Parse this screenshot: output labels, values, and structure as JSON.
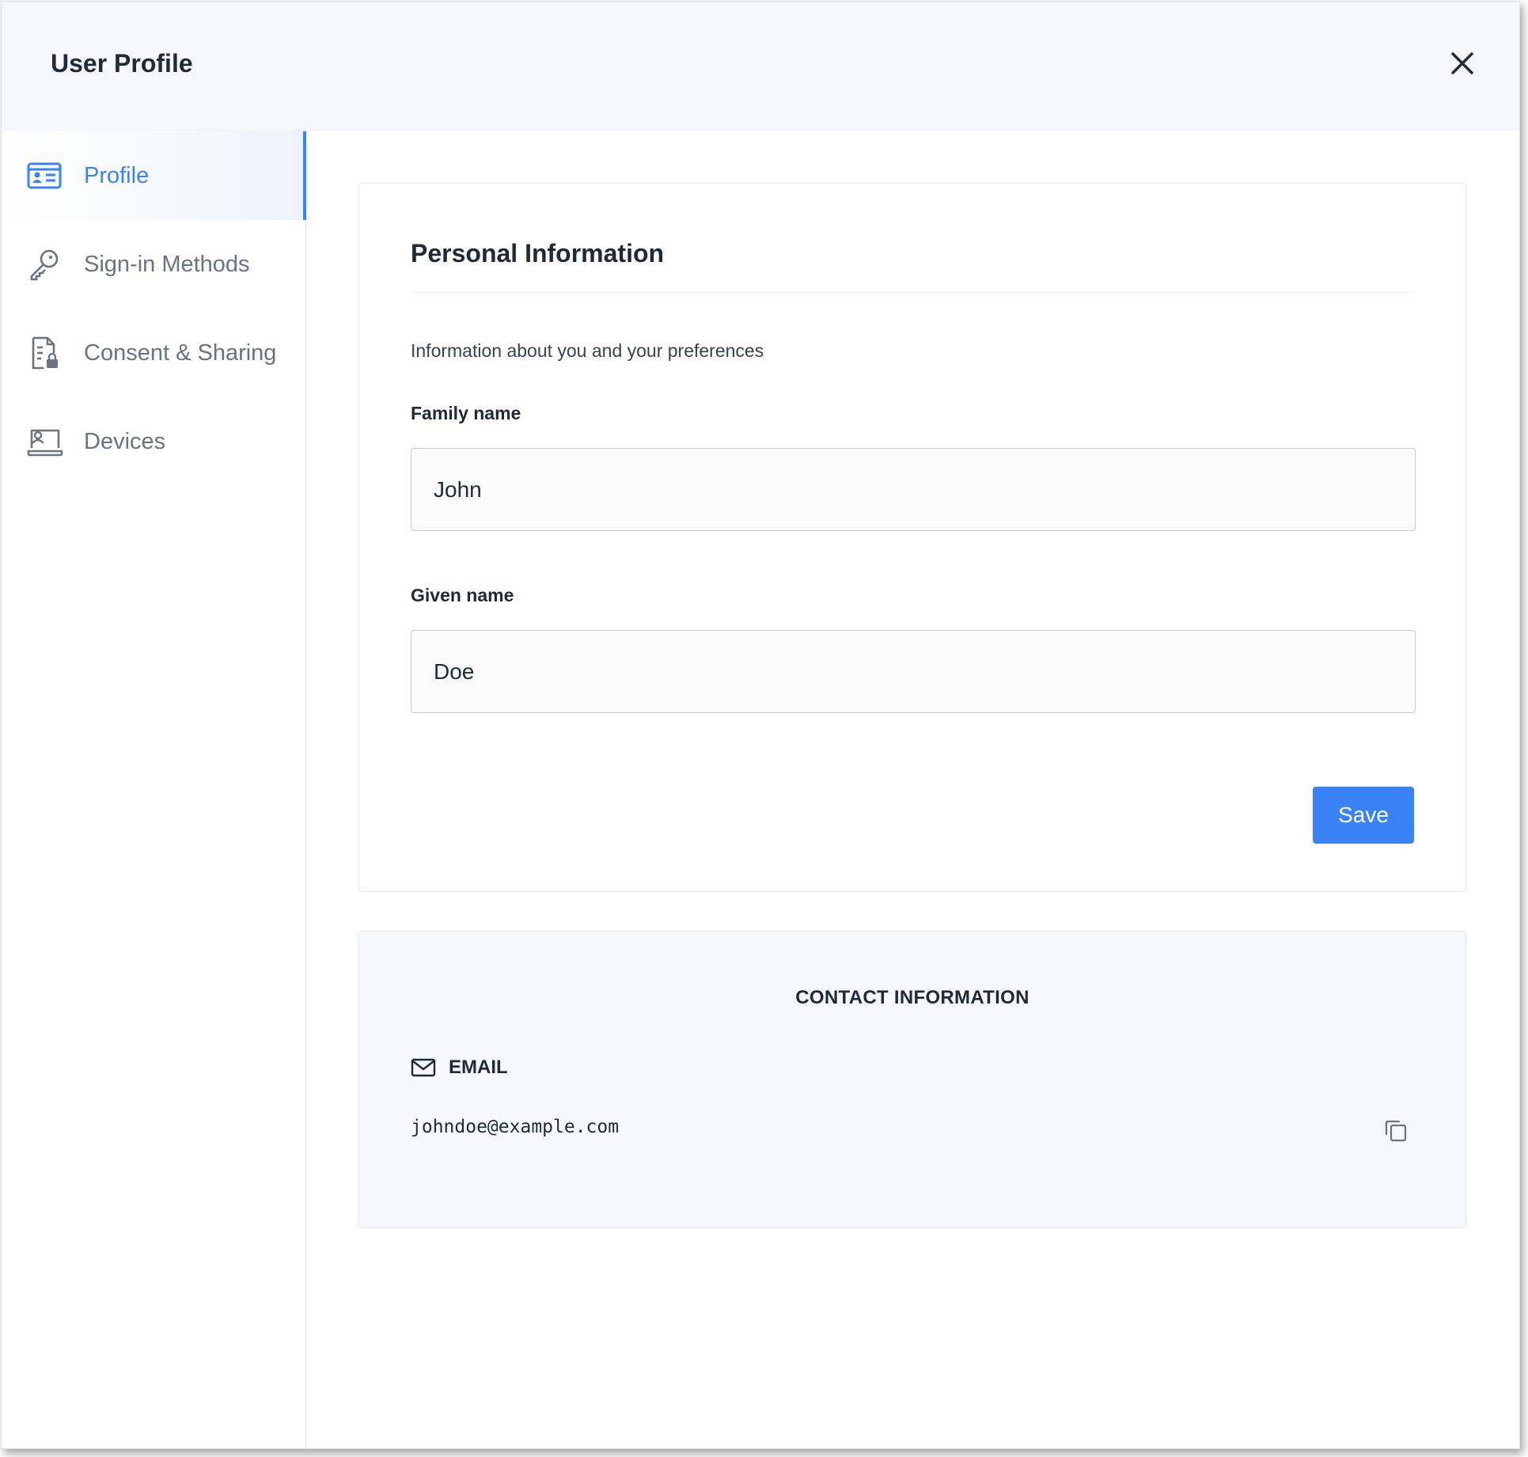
{
  "header": {
    "title": "User Profile",
    "close_icon": "close-icon"
  },
  "sidebar": {
    "items": [
      {
        "label": "Profile",
        "icon": "profile-card-icon",
        "active": true
      },
      {
        "label": "Sign-in Methods",
        "icon": "key-icon",
        "active": false
      },
      {
        "label": "Consent & Sharing",
        "icon": "document-lock-icon",
        "active": false
      },
      {
        "label": "Devices",
        "icon": "devices-icon",
        "active": false
      }
    ]
  },
  "personal_info": {
    "title": "Personal Information",
    "description": "Information about you and your preferences",
    "family_name": {
      "label": "Family name",
      "value": "John"
    },
    "given_name": {
      "label": "Given name",
      "value": "Doe"
    },
    "save_label": "Save"
  },
  "contact_info": {
    "title": "CONTACT INFORMATION",
    "email_label": "EMAIL",
    "email_value": "johndoe@example.com",
    "email_icon": "mail-icon",
    "copy_icon": "copy-icon"
  },
  "colors": {
    "accent": "#3b82f6",
    "header_bg": "#f6f8fd",
    "muted_text": "#6b7280"
  }
}
